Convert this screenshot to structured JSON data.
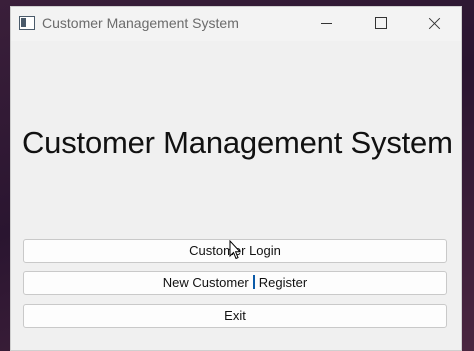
{
  "window": {
    "title": "Customer Management System"
  },
  "main": {
    "heading": "Customer Management System",
    "buttons": {
      "login": "Customer Login",
      "register_left": "New Customer",
      "register_right": "Register",
      "exit": "Exit"
    }
  },
  "icons": {
    "app": "app-window-icon",
    "minimize": "minimize-icon",
    "maximize": "maximize-icon",
    "close": "close-icon",
    "cursor": "mouse-pointer-icon"
  },
  "colors": {
    "window_bg": "#f0f0f0",
    "text_cursor": "#0a5aa8"
  }
}
